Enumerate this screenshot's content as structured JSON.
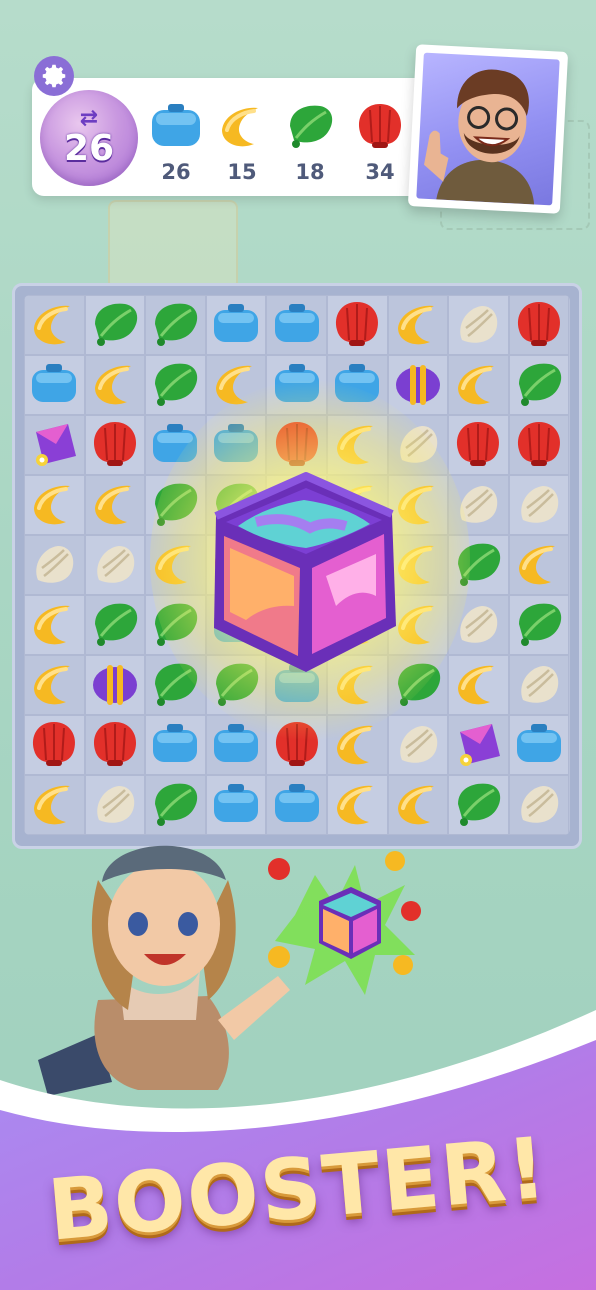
{
  "hud": {
    "moves_left": "26",
    "goals": [
      {
        "icon": "blue-suitcase-icon",
        "count": "26",
        "color": "#3a9fe0"
      },
      {
        "icon": "yellow-croissant-icon",
        "count": "15",
        "color": "#f4b21c"
      },
      {
        "icon": "green-leaf-icon",
        "count": "18",
        "color": "#2fa83a"
      },
      {
        "icon": "red-shell-icon",
        "count": "34",
        "color": "#e3302c"
      }
    ]
  },
  "board": {
    "rows": [
      [
        "croissant",
        "leaf",
        "leaf",
        "suitcase",
        "suitcase",
        "shell",
        "croissant",
        "conch",
        "shell"
      ],
      [
        "suitcase",
        "croissant",
        "leaf",
        "croissant",
        "suitcase",
        "suitcase",
        "candy",
        "croissant",
        "leaf"
      ],
      [
        "kite",
        "shell",
        "suitcase",
        "suitcase",
        "shell",
        "croissant",
        "conch",
        "shell",
        "shell"
      ],
      [
        "croissant",
        "croissant",
        "leaf",
        "leaf",
        "croissant",
        "croissant",
        "croissant",
        "conch",
        "conch"
      ],
      [
        "conch",
        "conch",
        "croissant",
        "shell",
        "conch",
        "croissant",
        "croissant",
        "leaf",
        "croissant"
      ],
      [
        "croissant",
        "leaf",
        "leaf",
        "suitcase",
        "croissant",
        "croissant",
        "croissant",
        "conch",
        "leaf"
      ],
      [
        "croissant",
        "candy",
        "leaf",
        "leaf",
        "suitcase",
        "croissant",
        "leaf",
        "croissant",
        "conch"
      ],
      [
        "shell",
        "shell",
        "suitcase",
        "suitcase",
        "shell",
        "croissant",
        "conch",
        "kite",
        "suitcase"
      ],
      [
        "croissant",
        "conch",
        "leaf",
        "suitcase",
        "suitcase",
        "croissant",
        "croissant",
        "leaf",
        "conch"
      ]
    ]
  },
  "banner": {
    "text": "BOOSTER!"
  },
  "colors": {
    "suitcase": "#3fa5e6",
    "croissant": "#f6b922",
    "leaf": "#2da63a",
    "shell": "#e2302a",
    "conch": "#e9e1cc",
    "purple": "#7b3fd1"
  }
}
